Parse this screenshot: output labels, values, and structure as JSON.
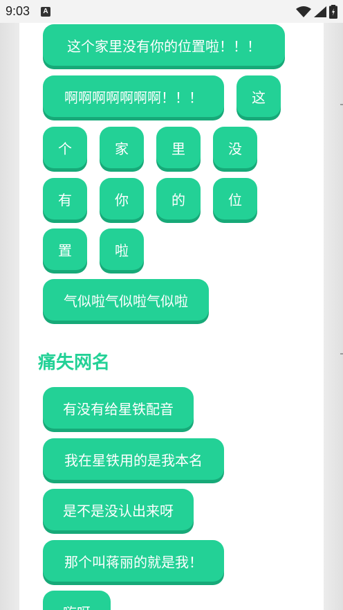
{
  "status_bar": {
    "time": "9:03",
    "notification_letter": "A",
    "icons": [
      "wifi-icon",
      "signal-icon",
      "battery-icon"
    ]
  },
  "colors": {
    "accent": "#23d196",
    "accent_shadow": "#17a978",
    "card_bg": "#ffffff",
    "page_bg": "#e7e7e7"
  },
  "buttons": [
    {
      "label": "这个家里没有你的位置啦！！！"
    },
    {
      "label": "啊啊啊啊啊啊啊！！！"
    },
    {
      "label": "这"
    },
    {
      "label": "个"
    },
    {
      "label": "家"
    },
    {
      "label": "里"
    },
    {
      "label": "没"
    },
    {
      "label": "有"
    },
    {
      "label": "你"
    },
    {
      "label": "的"
    },
    {
      "label": "位"
    },
    {
      "label": "置"
    },
    {
      "label": "啦"
    },
    {
      "label": "气似啦气似啦气似啦"
    }
  ],
  "section": {
    "title": "痛失网名",
    "buttons": [
      {
        "label": "有没有给星铁配音"
      },
      {
        "label": "我在星铁用的是我本名"
      },
      {
        "label": "是不是没认出来呀"
      },
      {
        "label": "那个叫蒋丽的就是我！"
      },
      {
        "label": "嗨呀"
      }
    ]
  }
}
